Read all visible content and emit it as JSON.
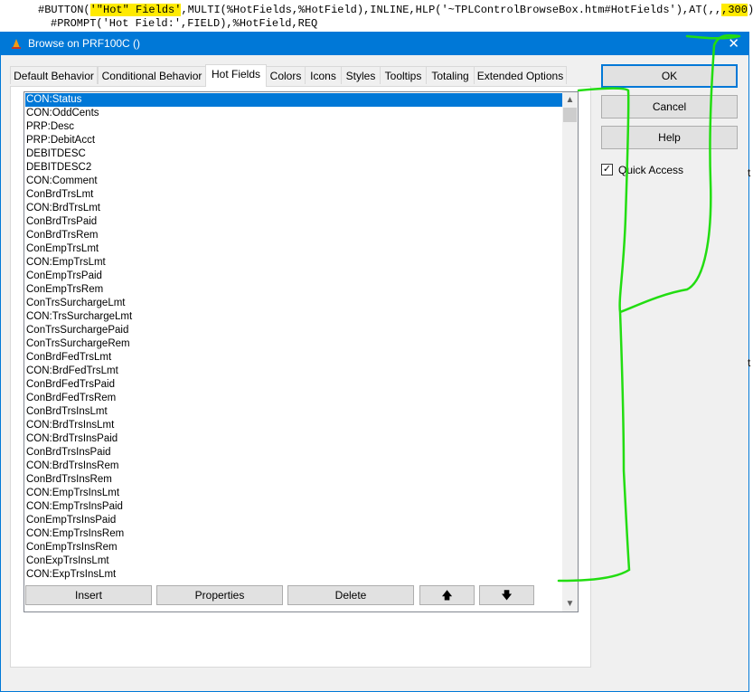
{
  "code": {
    "line1_pre": "#BUTTON(",
    "line1_hl": "'\"Hot\" Fields'",
    "line1_mid": ",MULTI(%HotFields,%HotField),INLINE,HLP('~TPLControlBrowseBox.htm#HotFields'),AT(,,",
    "line1_hl2": ",300",
    "line1_post": ")",
    "line2": "#PROMPT('Hot Field:',FIELD),%HotField,REQ"
  },
  "window": {
    "title": "Browse on PRF100C ()",
    "close_glyph": "✕"
  },
  "tabs": [
    {
      "label": "Default Behavior"
    },
    {
      "label": "Conditional Behavior"
    },
    {
      "label": "Hot Fields"
    },
    {
      "label": "Colors"
    },
    {
      "label": "Icons"
    },
    {
      "label": "Styles"
    },
    {
      "label": "Tooltips"
    },
    {
      "label": "Totaling"
    },
    {
      "label": "Extended Options"
    }
  ],
  "active_tab": "Hot Fields",
  "list": {
    "items": [
      "CON:Status",
      "CON:OddCents",
      "PRP:Desc",
      "PRP:DebitAcct",
      "DEBITDESC",
      "DEBITDESC2",
      "CON:Comment",
      "ConBrdTrsLmt",
      "CON:BrdTrsLmt",
      "ConBrdTrsPaid",
      "ConBrdTrsRem",
      "ConEmpTrsLmt",
      "CON:EmpTrsLmt",
      "ConEmpTrsPaid",
      "ConEmpTrsRem",
      "ConTrsSurchargeLmt",
      "CON:TrsSurchargeLmt",
      "ConTrsSurchargePaid",
      "ConTrsSurchargeRem",
      "ConBrdFedTrsLmt",
      "CON:BrdFedTrsLmt",
      "ConBrdFedTrsPaid",
      "ConBrdFedTrsRem",
      "ConBrdTrsInsLmt",
      "CON:BrdTrsInsLmt",
      "CON:BrdTrsInsPaid",
      "ConBrdTrsInsPaid",
      "CON:BrdTrsInsRem",
      "ConBrdTrsInsRem",
      "CON:EmpTrsInsLmt",
      "CON:EmpTrsInsPaid",
      "ConEmpTrsInsPaid",
      "CON:EmpTrsInsRem",
      "ConEmpTrsInsRem",
      "ConExpTrsInsLmt",
      "CON:ExpTrsInsLmt"
    ],
    "selected_index": 0
  },
  "list_buttons": {
    "insert": "Insert",
    "properties": "Properties",
    "delete": "Delete",
    "up_glyph": "🡅",
    "down_glyph": "🡇"
  },
  "side_buttons": {
    "ok": "OK",
    "cancel": "Cancel",
    "help": "Help"
  },
  "quick_access": {
    "label": "Quick Access",
    "checked": true,
    "check_glyph": "✓"
  },
  "right_edge_text": [
    "t",
    "t"
  ],
  "colors": {
    "accent": "#0078d7",
    "highlight": "#ffea00",
    "annotation": "#22dd11"
  }
}
